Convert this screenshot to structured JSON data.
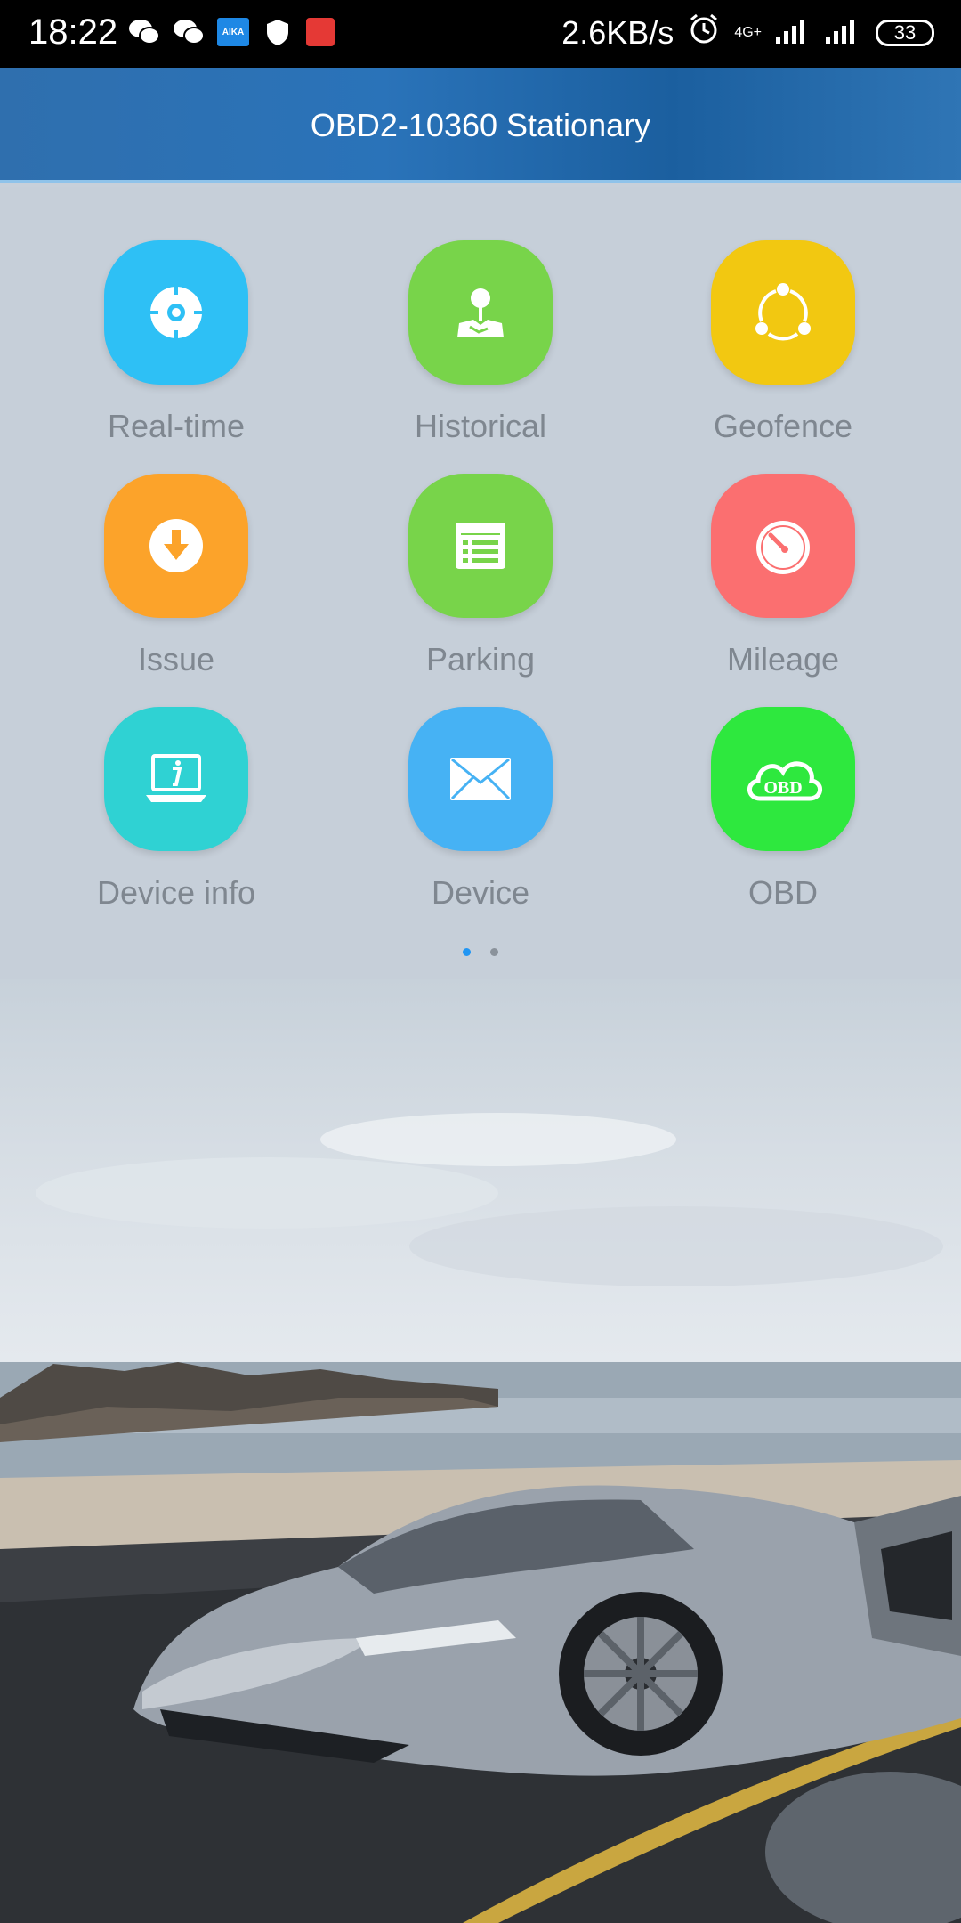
{
  "status_bar": {
    "time": "18:22",
    "network_speed": "2.6KB/s",
    "network_type": "4G+",
    "battery": "33"
  },
  "header": {
    "title": "OBD2-10360 Stationary"
  },
  "grid": [
    {
      "label": "Real-time",
      "color": "#2ec0f5",
      "icon": "target-icon"
    },
    {
      "label": "Historical",
      "color": "#78d44a",
      "icon": "map-pin-icon"
    },
    {
      "label": "Geofence",
      "color": "#f2c811",
      "icon": "geofence-icon"
    },
    {
      "label": "Issue",
      "color": "#fca32a",
      "icon": "download-icon"
    },
    {
      "label": "Parking",
      "color": "#78d44a",
      "icon": "list-icon"
    },
    {
      "label": "Mileage",
      "color": "#fb6f70",
      "icon": "gauge-icon"
    },
    {
      "label": "Device info",
      "color": "#2fd2d3",
      "icon": "laptop-info-icon"
    },
    {
      "label": "Device",
      "color": "#46b2f4",
      "icon": "mail-icon"
    },
    {
      "label": "OBD",
      "color": "#2ee83e",
      "icon": "obd-cloud-icon"
    }
  ],
  "pager": {
    "pages": 2,
    "active": 1
  },
  "obd_icon_text": "OBD"
}
